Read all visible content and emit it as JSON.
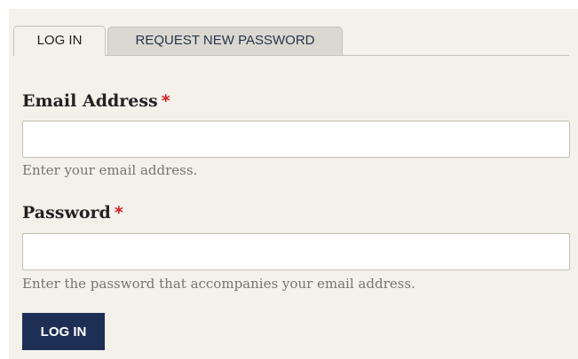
{
  "tabs": {
    "login_label": "LOG IN",
    "request_password_label": "REQUEST NEW PASSWORD"
  },
  "form": {
    "email": {
      "label": "Email Address",
      "required_mark": "*",
      "value": "",
      "help": "Enter your email address."
    },
    "password": {
      "label": "Password",
      "required_mark": "*",
      "value": "",
      "help": "Enter the password that accompanies your email address."
    },
    "submit_label": "LOG IN"
  },
  "colors": {
    "background": "#f4f1ea",
    "button": "#1e2f55",
    "required": "#d21f26",
    "inactive_tab": "#dbd8d1"
  }
}
